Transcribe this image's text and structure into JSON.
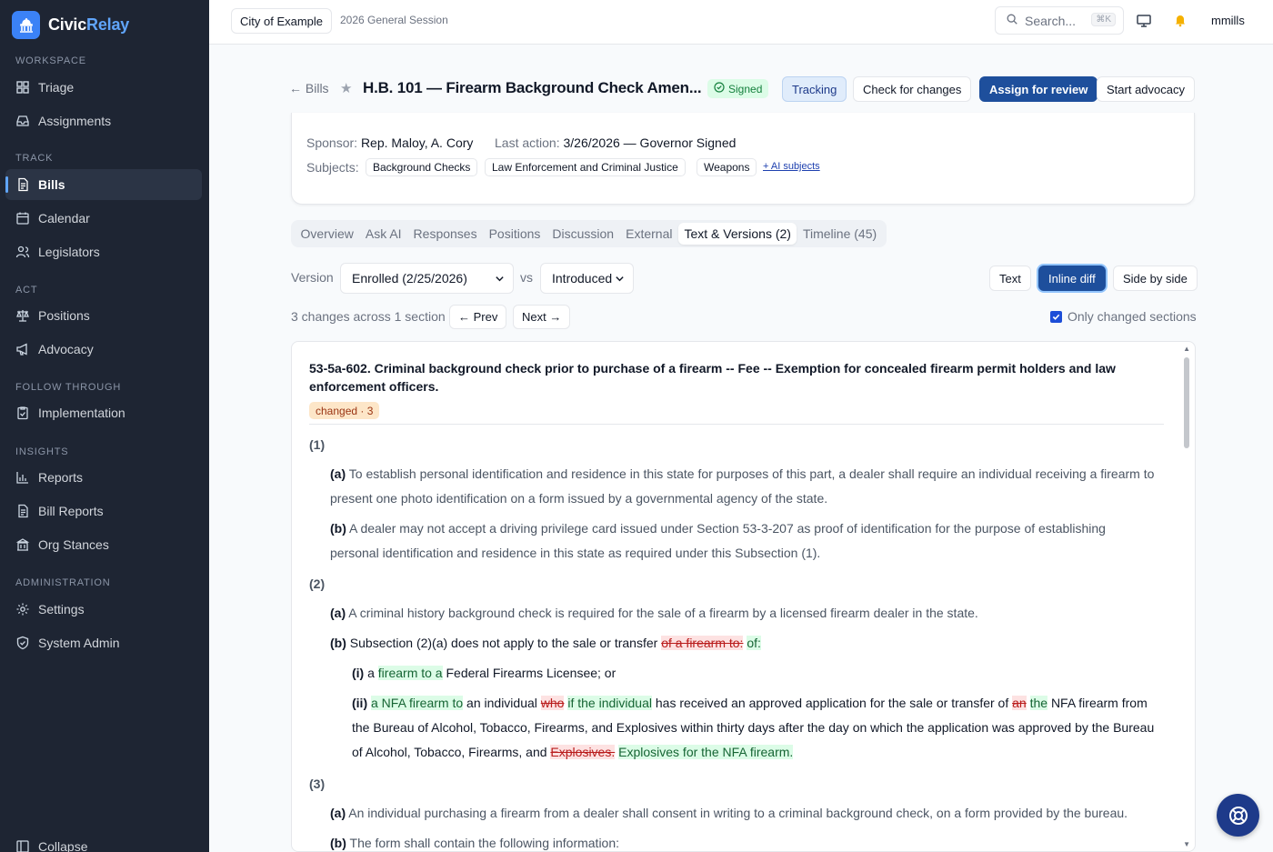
{
  "brand": {
    "name_a": "Civic",
    "name_b": "Relay"
  },
  "sidebar": {
    "sections": {
      "workspace": "WORKSPACE",
      "track": "TRACK",
      "act": "ACT",
      "follow": "FOLLOW THROUGH",
      "insights": "INSIGHTS",
      "admin": "ADMINISTRATION"
    },
    "items": {
      "triage": "Triage",
      "assignments": "Assignments",
      "bills": "Bills",
      "calendar": "Calendar",
      "legislators": "Legislators",
      "positions": "Positions",
      "advocacy": "Advocacy",
      "implementation": "Implementation",
      "reports": "Reports",
      "bill_reports": "Bill Reports",
      "org_stances": "Org Stances",
      "settings": "Settings",
      "system_admin": "System Admin",
      "collapse": "Collapse"
    }
  },
  "topbar": {
    "org": "City of Example",
    "session": "2026 General Session",
    "search_placeholder": "Search...",
    "shortcut": "⌘K",
    "user": "mmills"
  },
  "header": {
    "back": "← Bills",
    "star": "★",
    "title": "H.B. 101 — Firearm Background Check Amen...",
    "status": "Signed",
    "buttons": {
      "tracking": "Tracking",
      "check": "Check for changes",
      "assign": "Assign for review",
      "advocacy": "Start advocacy"
    }
  },
  "info": {
    "sponsor_label": "Sponsor:",
    "sponsor": "Rep. Maloy, A. Cory",
    "last_action_label": "Last action:",
    "last_action": "3/26/2026 — Governor Signed",
    "subjects_label": "Subjects:",
    "subjects": [
      "Background Checks",
      "Law Enforcement and Criminal Justice",
      "Weapons"
    ],
    "ai_subjects": "+ AI subjects"
  },
  "tabs": [
    "Overview",
    "Ask AI",
    "Responses",
    "Positions",
    "Discussion",
    "External",
    "Text & Versions (2)",
    "Timeline (45)"
  ],
  "versions": {
    "label": "Version",
    "left": "Enrolled (2/25/2026)",
    "vs": "vs",
    "right": "Introduced",
    "views": {
      "text": "Text",
      "inline": "Inline diff",
      "side": "Side by side"
    },
    "summary": "3 changes across 1 section",
    "prev": "← Prev",
    "next": "Next →",
    "only_changed": "Only changed sections"
  },
  "doc": {
    "section_title": "53-5a-602. Criminal background check prior to purchase of a firearm -- Fee -- Exemption for concealed firearm permit holders and law enforcement officers.",
    "changed_badge": "changed · 3",
    "n1": "(1)",
    "p1a_num": "(a)",
    "p1a_l1": "To establish personal identification and residence in this state for purposes of this part, a dealer shall require an individual receiving a firearm to",
    "p1a_l2": "present one photo identification on a form issued by a governmental agency of the state.",
    "p1b_num": "(b)",
    "p1b_l1": "A dealer may not accept a driving privilege card issued under Section 53-3-207 as proof of identification for the purpose of establishing",
    "p1b_l2": "personal identification and residence in this state as required under this Subsection (1).",
    "n2": "(2)",
    "p2a_num": "(a)",
    "p2a": "A criminal history background check is required for the sale of a firearm by a licensed firearm dealer in the state.",
    "p2b_num": "(b)",
    "p2b_pre": "Subsection (2)(a) does not apply to the sale or transfer",
    "p2b_del": "of a firearm to:",
    "p2b_ins": "of:",
    "p2i_num": "(i)",
    "p2i_pre": "a",
    "p2i_ins": "firearm to a",
    "p2i_post": "Federal Firearms Licensee; or",
    "p2ii_num": "(ii)",
    "p2ii_ins1": "a NFA firearm to",
    "p2ii_t1": "an individual",
    "p2ii_del1": "who",
    "p2ii_ins2": "if the individual",
    "p2ii_t2": "has received an approved application for the sale or transfer of",
    "p2ii_del2": "an",
    "p2ii_ins3": "the",
    "p2ii_t3": "NFA firearm from",
    "p2ii_l2": "the Bureau of Alcohol, Tobacco, Firearms, and Explosives within thirty days after the day on which the application was approved by the Bureau",
    "p2ii_l3_pre": "of Alcohol, Tobacco, Firearms, and",
    "p2ii_del3": "Explosives.",
    "p2ii_ins4": "Explosives for the NFA firearm.",
    "n3": "(3)",
    "p3a_num": "(a)",
    "p3a": "An individual purchasing a firearm from a dealer shall consent in writing to a criminal background check, on a form provided by the bureau.",
    "p3b_num": "(b)",
    "p3b": "The form shall contain the following information:"
  }
}
